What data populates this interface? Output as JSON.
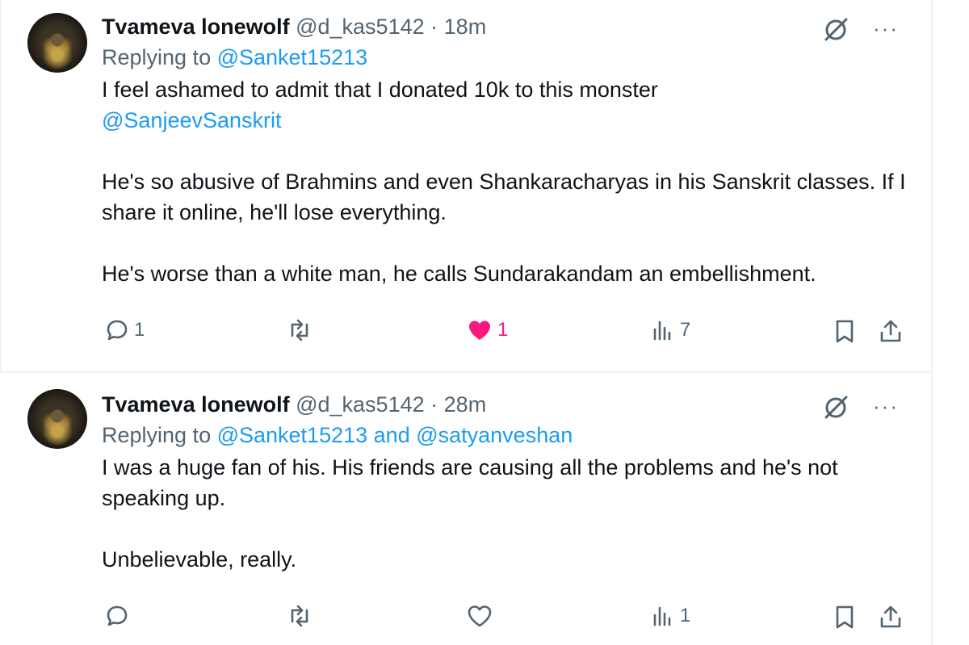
{
  "tweets": [
    {
      "name": "Tvameva lonewolf",
      "handle": "@d_kas5142",
      "dot": "·",
      "time": "18m",
      "replying_prefix": "Replying to ",
      "replying_to": [
        "@Sanket15213"
      ],
      "replying_joiner": "",
      "body": {
        "line1": "I feel ashamed to admit that I donated 10k to this monster",
        "mention": "@SanjeevSanskrit",
        "para2": "He's so abusive of Brahmins and even Shankaracharyas in his Sanskrit classes. If I share it online, he'll lose everything.",
        "para3": "He's worse than a white man, he calls Sundarakandam an embellishment."
      },
      "actions": {
        "replies": "1",
        "reposts": "",
        "likes": "1",
        "views": "7",
        "liked": true
      }
    },
    {
      "name": "Tvameva lonewolf",
      "handle": "@d_kas5142",
      "dot": "·",
      "time": "28m",
      "replying_prefix": "Replying to ",
      "replying_to": [
        "@Sanket15213",
        "@satyanveshan"
      ],
      "replying_joiner": " and ",
      "body": {
        "para1": "I was a huge fan of his. His friends are causing all the problems and he's not speaking up.",
        "para2": "Unbelievable, really."
      },
      "actions": {
        "replies": "",
        "reposts": "",
        "likes": "",
        "views": "1",
        "liked": false
      }
    }
  ],
  "icons": {
    "top": [
      "grok-icon",
      "more-icon"
    ],
    "actions": [
      "reply-icon",
      "repost-icon",
      "like-icon",
      "views-icon",
      "bookmark-icon",
      "share-icon"
    ]
  },
  "colors": {
    "text": "#0f1419",
    "muted": "#536471",
    "link": "#1d9bf0",
    "like": "#f91880",
    "border": "#eff3f4"
  },
  "more_glyph": "···"
}
